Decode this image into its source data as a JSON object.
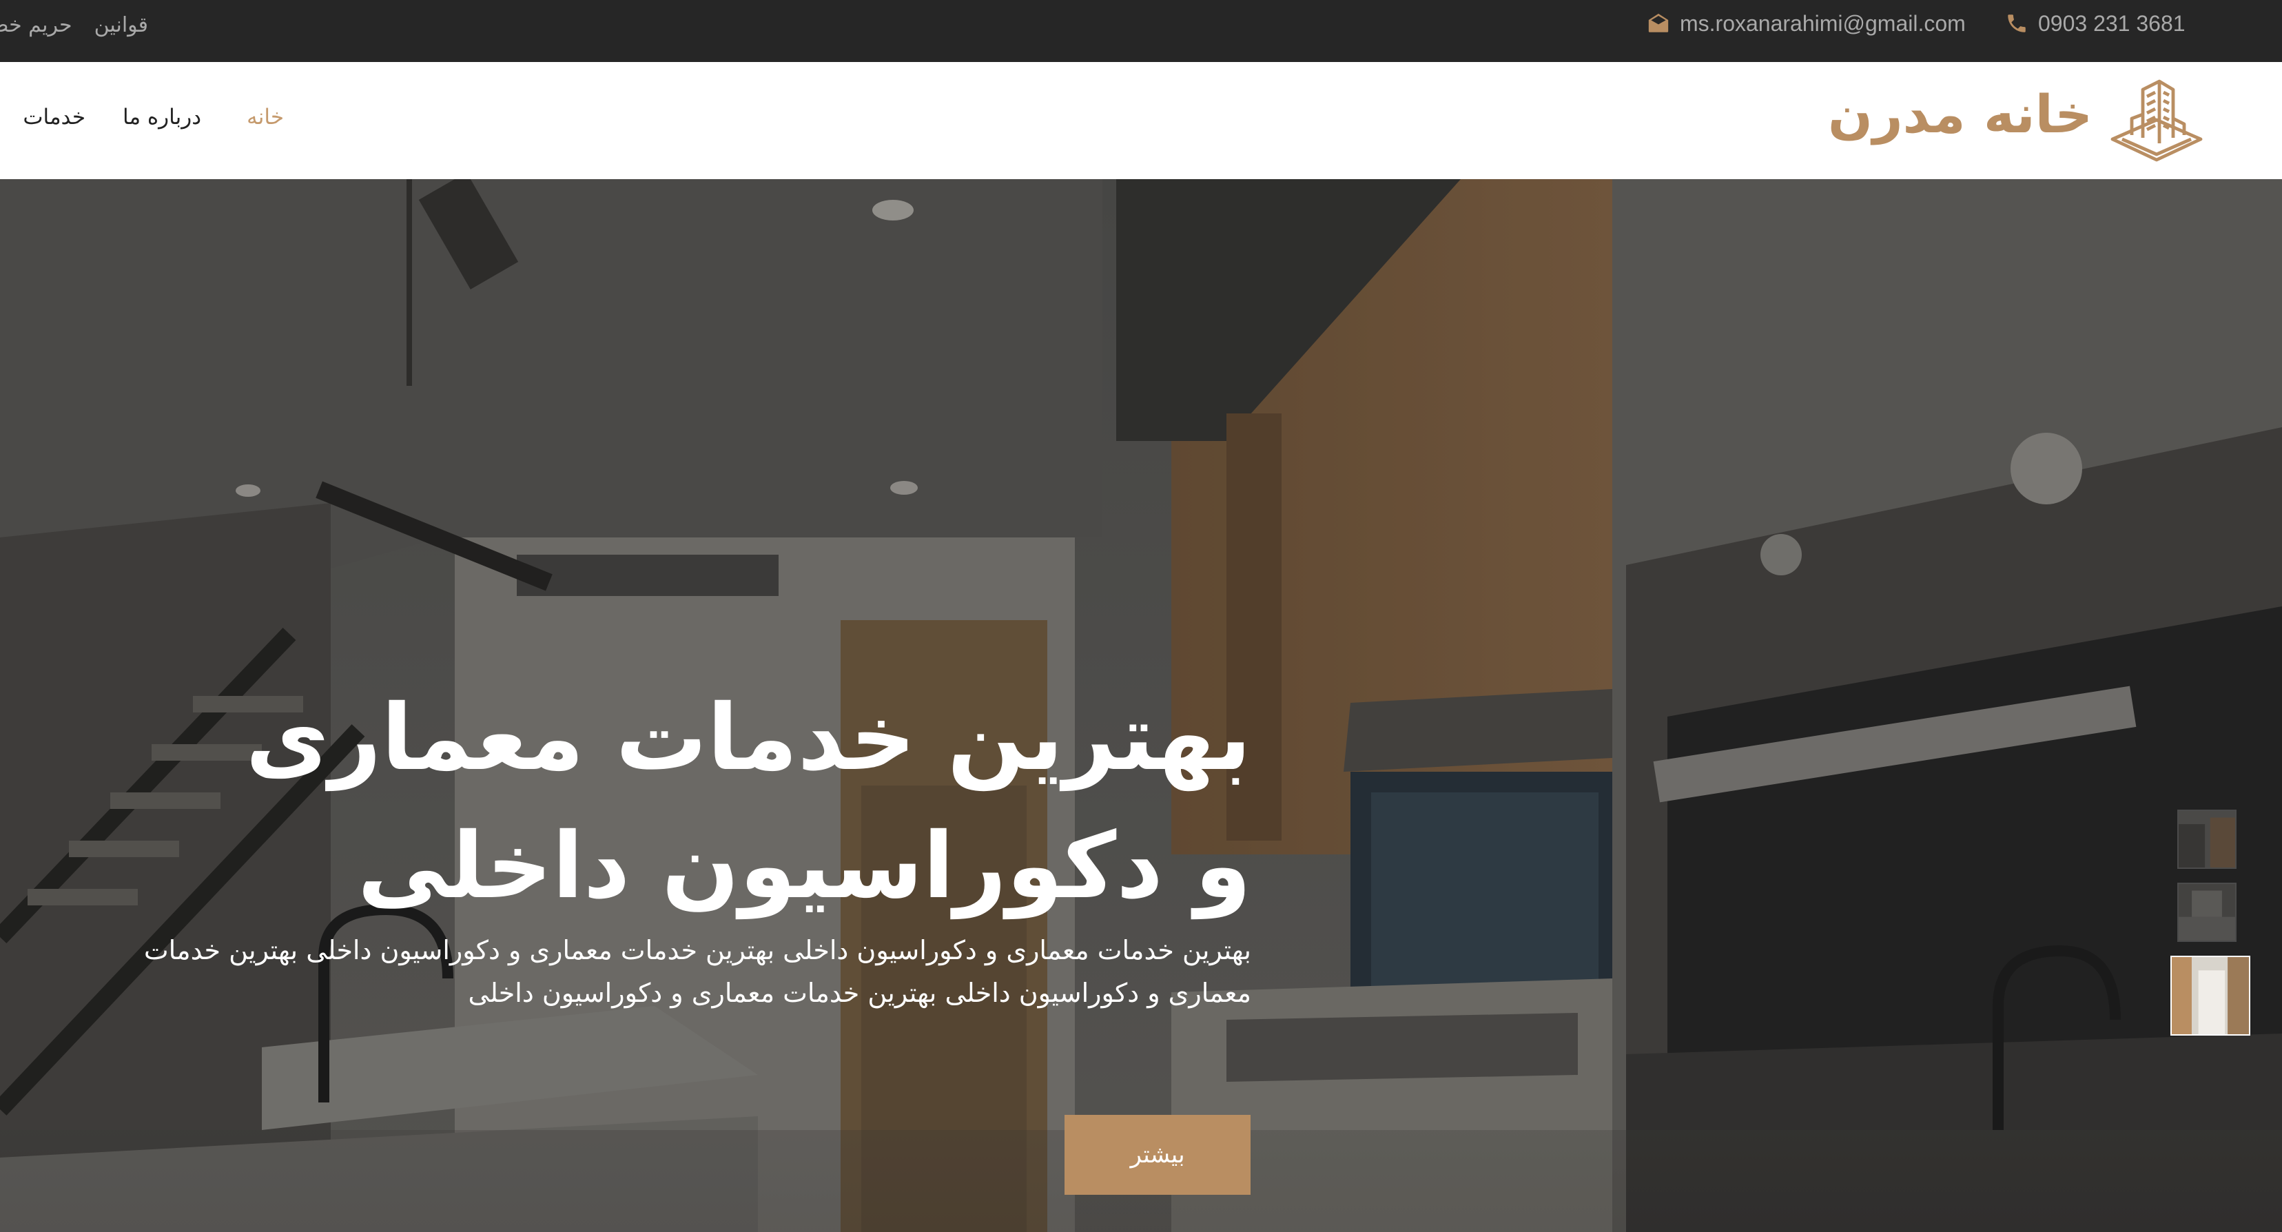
{
  "topbar": {
    "phone": "0903 231 3681",
    "email": "ms.roxanarahimi@gmail.com",
    "links": [
      "قوانین",
      "حریم خصوصی"
    ]
  },
  "header": {
    "logo_text": "خانه مدرن",
    "nav": {
      "home": "خانه",
      "about": "درباره ما",
      "services": "خدمات"
    }
  },
  "hero": {
    "title": "بهترین خدمات معماری و دکوراسیون داخلی",
    "description": "بهترین خدمات معماری و دکوراسیون داخلی بهترین خدمات معماری و دکوراسیون داخلی بهترین خدمات معماری و دکوراسیون داخلی بهترین خدمات معماری و دکوراسیون داخلی",
    "button": "بیشتر"
  },
  "colors": {
    "accent": "#b98e62",
    "topbar_bg": "#262626",
    "nav_active": "#c59a6d"
  },
  "icons": {
    "phone": "phone-icon",
    "email": "envelope-icon",
    "logo": "building-icon"
  }
}
